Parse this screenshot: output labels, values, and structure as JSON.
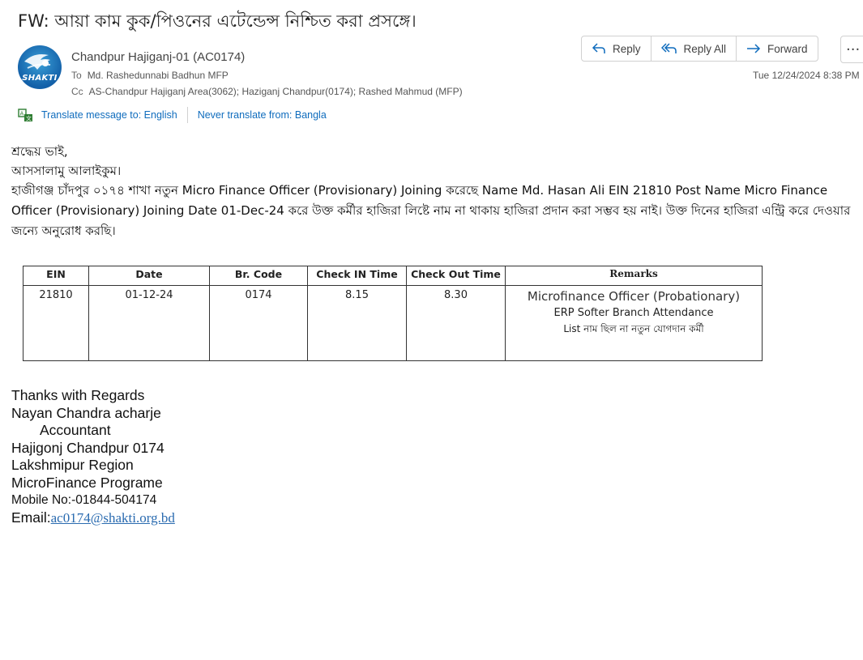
{
  "subject": "FW: আয়া কাম কুক/পিওনের এটেন্ডেন্স নিশ্চিত করা প্রসঙ্গে।",
  "avatar": {
    "text": "SHAKTI"
  },
  "sender": "Chandpur Hajiganj-01 (AC0174)",
  "to": {
    "label": "To",
    "value": "Md. Rashedunnabi Badhun MFP"
  },
  "cc": {
    "label": "Cc",
    "value": "AS-Chandpur Hajiganj Area(3062); Haziganj Chandpur(0174); Rashed Mahmud (MFP)"
  },
  "date": "Tue 12/24/2024 8:38 PM",
  "actions": {
    "reply": "Reply",
    "reply_all": "Reply All",
    "forward": "Forward",
    "more": "···"
  },
  "translate": {
    "translate_label": "Translate message to: English",
    "never_label": "Never translate from: Bangla"
  },
  "body": {
    "greeting": "শ্রদ্ধেয় ভাই,",
    "salam": "আসসালামু আলাইকুম।",
    "paragraph": "হাজীগঞ্জ চাঁদপুর ০১৭৪ শাখা নতুন Micro Finance Officer (Provisionary) Joining  করেছে  Name  Md. Hasan Ali EIN  21810  Post Name Micro Finance Officer (Provisionary) Joining Date 01-Dec-24 করে উক্ত কর্মীর হাজিরা  লিষ্টে নাম না থাকায়  হাজিরা প্রদান করা সম্ভব হয় নাই। উক্ত দিনের হাজিরা এন্ট্রি করে দেওয়ার জন্যে অনুরোধ করছি।"
  },
  "table": {
    "headers": [
      "EIN",
      "Date",
      "Br. Code",
      "Check IN Time",
      "Check Out Time",
      "Remarks"
    ],
    "row": {
      "ein": "21810",
      "date": "01-12-24",
      "br_code": "0174",
      "check_in": "8.15",
      "check_out": "8.30",
      "remarks_1": "Microfinance Officer (Probationary)",
      "remarks_2": "ERP Softer Branch Attendance",
      "remarks_3": "List নাম ছিল না নতুন যোগদান কর্মী"
    }
  },
  "signature": {
    "thanks": "Thanks with Regards",
    "name": "Nayan Chandra acharje",
    "title": "Accountant",
    "branch": "Hajigonj Chandpur 0174",
    "region": "Lakshmipur Region",
    "program": "MicroFinance  Programe",
    "mobile": "Mobile No:-01844-504174",
    "email_label": "Email:",
    "email": "ac0174@shakti.org.bd"
  }
}
